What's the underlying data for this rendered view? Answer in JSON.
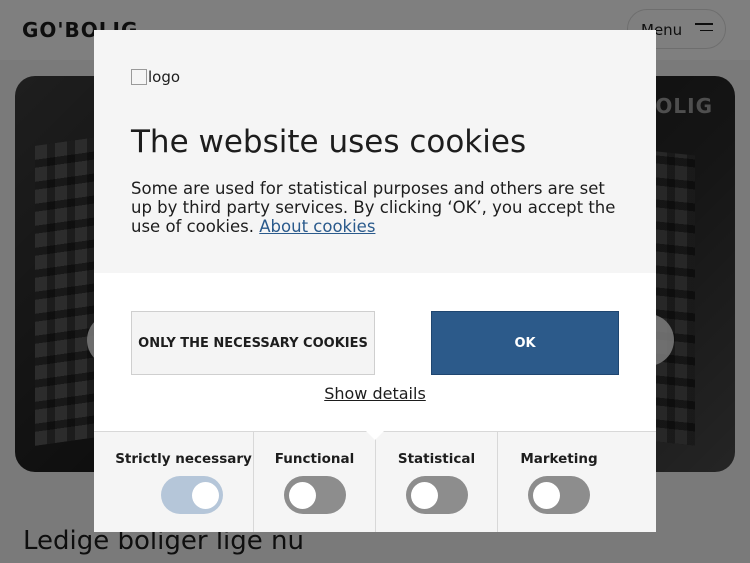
{
  "header": {
    "brand": "GO'BOLIG",
    "menu_label": "Menu"
  },
  "hero": {
    "brand": "GO'BOLIG"
  },
  "page": {
    "heading": "Ledige boliger lige nu"
  },
  "cookie_dialog": {
    "logo_alt": "logo",
    "title": "The website uses cookies",
    "body": "Some are used for statistical purposes and others are set up by third party services. By clicking ‘OK’, you accept the use of cookies.",
    "about_link": "About cookies",
    "necessary_button": "ONLY THE NECESSARY COOKIES",
    "ok_button": "OK",
    "show_details": "Show details",
    "categories": [
      {
        "label": "Strictly necessary",
        "checked": true,
        "disabled": true
      },
      {
        "label": "Functional",
        "checked": false
      },
      {
        "label": "Statistical",
        "checked": false
      },
      {
        "label": "Marketing",
        "checked": false
      }
    ]
  },
  "colors": {
    "ok_button": "#2c5a8a",
    "link": "#2a5a8c",
    "toggle_off": "#8d8d8d",
    "toggle_on_disabled": "#b5c6d9"
  }
}
